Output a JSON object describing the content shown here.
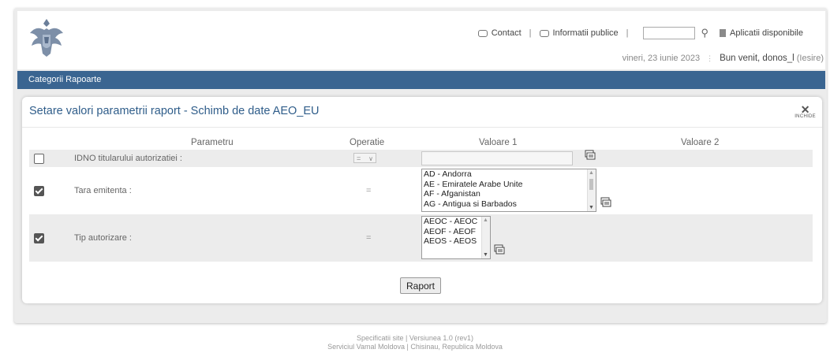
{
  "header": {
    "contact_label": "Contact",
    "public_info_label": "Informatii publice",
    "apps_label": "Aplicatii disponibile",
    "date": "vineri, 23 iunie 2023",
    "welcome": "Bun venit, donos_l",
    "logout": "(Iesire)"
  },
  "category_bar": {
    "label": "Categorii Rapoarte"
  },
  "card": {
    "title": "Setare valori parametrii raport - Schimb de date AEO_EU",
    "close_label": "INCHIDE",
    "columns": [
      "Parametru",
      "Operatie",
      "Valoare 1",
      "Valoare 2"
    ],
    "rows": [
      {
        "label": "IDNO titularului autorizatiei :",
        "checked": false,
        "operation": "="
      },
      {
        "label": "Tara emitenta :",
        "checked": true,
        "operation": "=",
        "options": [
          "AD - Andorra",
          "AE - Emiratele Arabe Unite",
          "AF - Afganistan",
          "AG - Antigua si Barbados"
        ]
      },
      {
        "label": "Tip autorizare :",
        "checked": true,
        "operation": "=",
        "options": [
          "AEOC - AEOC",
          "AEOF - AEOF",
          "AEOS - AEOS"
        ]
      }
    ],
    "submit_label": "Raport"
  },
  "footer": {
    "line1": "Specificatii site  |  Versiunea 1.0 (rev1)",
    "line2": "Serviciul Vamal Moldova | Chisinau, Republica Moldova"
  },
  "colors": {
    "accent": "#3a6591",
    "title": "#2f5d8a"
  },
  "icons": [
    "coat-of-arms-logo",
    "envelope-icon",
    "search-icon",
    "apps-icon",
    "close-icon",
    "value-picker-icon"
  ]
}
